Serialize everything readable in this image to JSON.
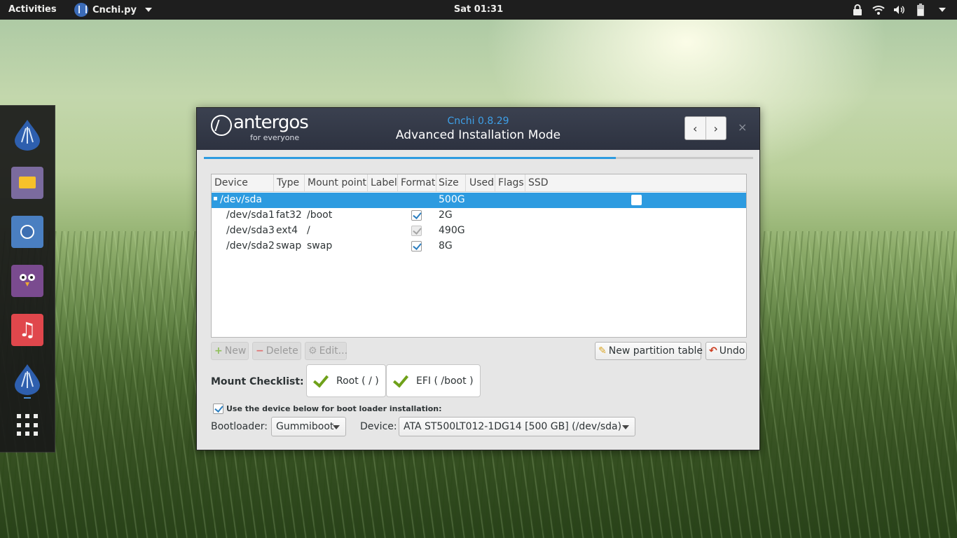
{
  "topbar": {
    "activities": "Activities",
    "app_name": "Cnchi.py",
    "clock": "Sat 01:31"
  },
  "dock": {
    "items": [
      "antergos-icon",
      "files-icon",
      "chromium-icon",
      "pidgin-icon",
      "music-icon",
      "cnchi-icon",
      "app-grid-icon"
    ]
  },
  "window": {
    "logo_word": "antergos",
    "logo_tagline": "for everyone",
    "title": "Cnchi 0.8.29",
    "subtitle": "Advanced Installation Mode",
    "back_glyph": "‹",
    "forward_glyph": "›",
    "close_glyph": "×",
    "progress_fraction": 0.75
  },
  "table": {
    "columns": [
      "Device",
      "Type",
      "Mount point",
      "Label",
      "Format",
      "Size",
      "Used",
      "Flags",
      "SSD"
    ],
    "rows": [
      {
        "device": "/dev/sda",
        "type": "",
        "mount": "",
        "format": null,
        "size": "500G",
        "ssd": false,
        "selected": true
      },
      {
        "device": "/dev/sda1",
        "type": "fat32",
        "mount": "/boot",
        "format": "checked",
        "size": "2G",
        "selected": false
      },
      {
        "device": "/dev/sda3",
        "type": "ext4",
        "mount": "/",
        "format": "checked-disabled",
        "size": "490G",
        "selected": false
      },
      {
        "device": "/dev/sda2",
        "type": "swap",
        "mount": "swap",
        "format": "checked",
        "size": "8G",
        "selected": false
      }
    ]
  },
  "actions": {
    "new": "New",
    "delete": "Delete",
    "edit": "Edit...",
    "new_partition_table": "New partition table",
    "undo": "Undo"
  },
  "checklist": {
    "label": "Mount Checklist:",
    "items": [
      "Root ( / )",
      "EFI ( /boot )"
    ]
  },
  "bootloader": {
    "use_device_label": "Use the device below for boot loader installation:",
    "use_device_checked": true,
    "bootloader_label": "Bootloader:",
    "bootloader_value": "Gummiboot",
    "device_label": "Device:",
    "device_value": "ATA ST500LT012-1DG14 [500 GB] (/dev/sda)"
  },
  "colors": {
    "accent": "#2d9be0",
    "header_bg": "#2f3442",
    "title_blue": "#3ea0e8",
    "check_green": "#6fa11a"
  }
}
